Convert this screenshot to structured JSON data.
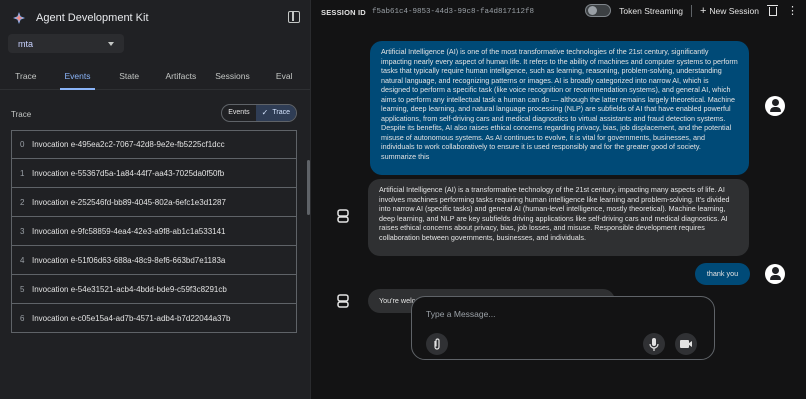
{
  "sidebar": {
    "brand_title": "Agent Development Kit",
    "app_select_value": "mta",
    "tabs": [
      {
        "label": "Trace",
        "active": false
      },
      {
        "label": "Events",
        "active": true
      },
      {
        "label": "State",
        "active": false
      },
      {
        "label": "Artifacts",
        "active": false
      },
      {
        "label": "Sessions",
        "active": false
      },
      {
        "label": "Eval",
        "active": false
      }
    ],
    "trace_label": "Trace",
    "toggle": {
      "events": "Events",
      "trace": "Trace",
      "selected": "Trace"
    },
    "invocations": [
      {
        "index": "0",
        "name": "Invocation e-495ea2c2-7067-42d8-9e2e-fb5225cf1dcc"
      },
      {
        "index": "1",
        "name": "Invocation e-55367d5a-1a84-44f7-aa43-7025da0f50fb"
      },
      {
        "index": "2",
        "name": "Invocation e-252546fd-bb89-4045-802a-6efc1e3d1287"
      },
      {
        "index": "3",
        "name": "Invocation e-9fc58859-4ea4-42e3-a9f8-ab1c1a533141"
      },
      {
        "index": "4",
        "name": "Invocation e-51f06d63-688a-48c9-8ef6-663bd7e1183a"
      },
      {
        "index": "5",
        "name": "Invocation e-54e31521-acb4-4bdd-bde9-c59f3c8291cb"
      },
      {
        "index": "6",
        "name": "Invocation e-c05e15a4-ad7b-4571-adb4-b7d22044a37b"
      }
    ]
  },
  "topbar": {
    "session_label": "SESSION ID",
    "session_id": "f5ab61c4-9853-44d3-99c8-fa4d817112f8",
    "token_streaming": "Token Streaming",
    "new_session": "New Session"
  },
  "messages": [
    {
      "role": "user",
      "text": "Artificial Intelligence (AI) is one of the most transformative technologies of the 21st century, significantly impacting nearly every aspect of human life. It refers to the ability of machines and computer systems to perform tasks that typically require human intelligence, such as learning, reasoning, problem-solving, understanding natural language, and recognizing patterns or images. AI is broadly categorized into narrow AI, which is designed to perform a specific task (like voice recognition or recommendation systems), and general AI, which aims to perform any intellectual task a human can do — although the latter remains largely theoretical. Machine learning, deep learning, and natural language processing (NLP) are subfields of AI that have enabled powerful applications, from self-driving cars and medical diagnostics to virtual assistants and fraud detection systems. Despite its benefits, AI also raises ethical concerns regarding privacy, bias, job displacement, and the potential misuse of autonomous systems. As AI continues to evolve, it is vital for governments, businesses, and individuals to work collaboratively to ensure it is used responsibly and for the greater good of society.\nsummarize this"
    },
    {
      "role": "bot",
      "text": "Artificial Intelligence (AI) is a transformative technology of the 21st century, impacting many aspects of life. AI involves machines performing tasks requiring human intelligence like learning and problem-solving. It's divided into narrow AI (specific tasks) and general AI (human-level intelligence, mostly theoretical). Machine learning, deep learning, and NLP are key subfields driving applications like self-driving cars and medical diagnostics. AI raises ethical concerns about privacy, bias, job losses, and misuse. Responsible development requires collaboration between governments, businesses, and individuals."
    },
    {
      "role": "user",
      "text": "thank you"
    },
    {
      "role": "bot",
      "text": "You're welcome! Is there anything else I can help you with today?"
    }
  ],
  "composer": {
    "placeholder": "Type a Message..."
  },
  "colors": {
    "accent": "#8ab4f8",
    "user_bubble": "#004a77",
    "bot_bubble": "#2f3032",
    "background": "#131314",
    "sidebar": "#202124"
  },
  "icons": [
    "agent-logo-icon",
    "collapse-sidebar-icon",
    "chevron-down-icon",
    "check-icon",
    "plus-icon",
    "trash-icon",
    "more-vert-icon",
    "person-icon",
    "bot-icon",
    "attach-icon",
    "mic-icon",
    "videocam-icon"
  ]
}
